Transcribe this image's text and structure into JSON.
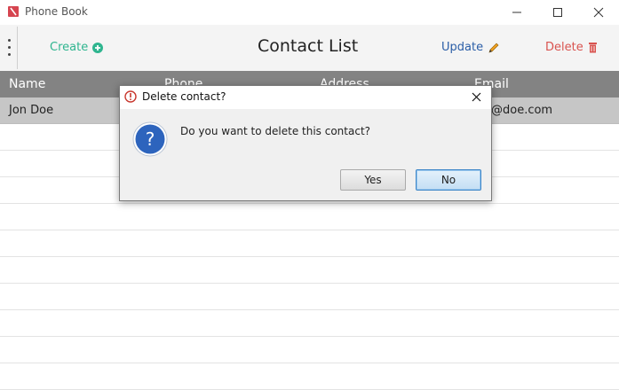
{
  "window": {
    "title": "Phone Book"
  },
  "toolbar": {
    "create_label": "Create",
    "title": "Contact List",
    "update_label": "Update",
    "delete_label": "Delete"
  },
  "table": {
    "columns": [
      "Name",
      "Phone",
      "Address",
      "Email"
    ],
    "rows": [
      {
        "name": "Jon Doe",
        "email": "@doe.com"
      }
    ]
  },
  "dialog": {
    "title": "Delete contact?",
    "message": "Do you want to delete this contact?",
    "yes_label": "Yes",
    "no_label": "No"
  },
  "colors": {
    "create": "#2fb58f",
    "update": "#2b5ea7",
    "delete": "#d9534f",
    "header_bg": "#838383",
    "selected_row": "#c6c6c6",
    "dialog_default_button": "#3c86c8"
  }
}
